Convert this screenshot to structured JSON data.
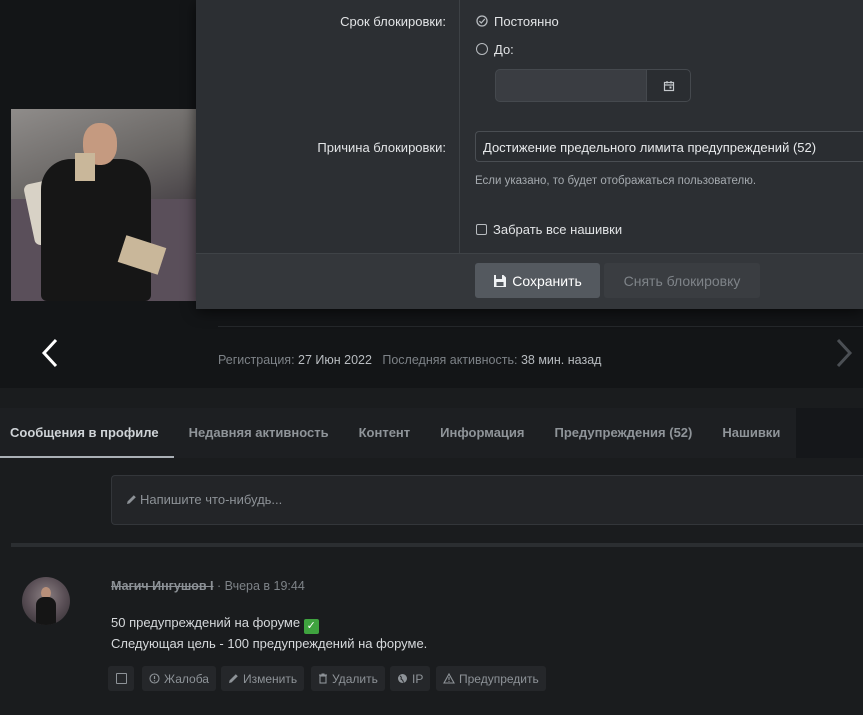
{
  "modal": {
    "duration_label": "Срок блокировки:",
    "option_permanent": "Постоянно",
    "option_until": "До:",
    "date_value": "",
    "reason_label": "Причина блокировки:",
    "reason_value": "Достижение предельного лимита предупреждений (52)",
    "reason_hint": "Если указано, то будет отображаться пользователю.",
    "remove_badges": "Забрать все нашивки",
    "save_button": "Сохранить",
    "unblock_button": "Снять блокировку"
  },
  "profile": {
    "reg_label": "Регистрация:",
    "reg_value": "27 Июн 2022",
    "activity_label": "Последняя активность:",
    "activity_value": "38 мин. назад"
  },
  "tabs": [
    {
      "label": "Сообщения в профиле",
      "active": true
    },
    {
      "label": "Недавняя активность"
    },
    {
      "label": "Контент"
    },
    {
      "label": "Информация"
    },
    {
      "label": "Предупреждения (52)"
    },
    {
      "label": "Нашивки"
    }
  ],
  "composer": {
    "placeholder": "Напишите что-нибудь..."
  },
  "post": {
    "author": "Магич Ингушов I",
    "time": "Вчера в 19:44",
    "line1": "50 предупреждений на форуме",
    "emoji": "✓",
    "line2": "Следующая цель - 100 предупреждений на форуме.",
    "actions": {
      "report": "Жалоба",
      "edit": "Изменить",
      "delete": "Удалить",
      "ip": "IP",
      "warn": "Предупредить"
    }
  },
  "colors": {
    "modal_bg": "#2c2f33",
    "page_bg": "#1a1c1e",
    "save_btn": "#54595f",
    "emoji_green": "#3fa33f"
  }
}
